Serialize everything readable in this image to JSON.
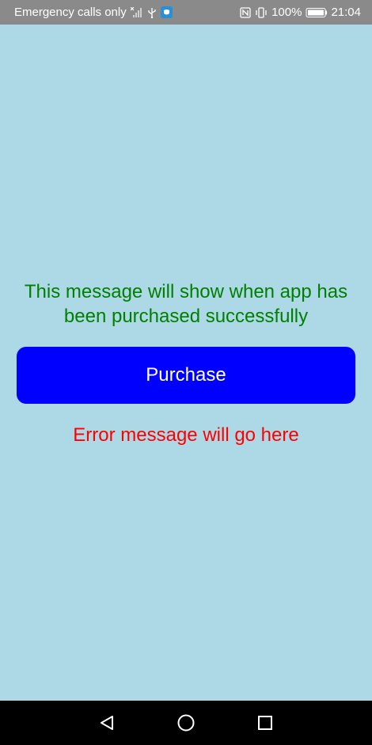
{
  "status_bar": {
    "carrier_text": "Emergency calls only",
    "battery_percent": "100%",
    "time": "21:04",
    "icons": [
      "no-signal-icon",
      "usb-icon",
      "app-notification-icon",
      "nfc-icon",
      "vibrate-icon",
      "battery-icon"
    ]
  },
  "main": {
    "success_message": "This message will show when app has been purchased successfully",
    "purchase_label": "Purchase",
    "error_message": "Error message will go here"
  },
  "nav_bar": {
    "icons": [
      "back-icon",
      "home-icon",
      "recents-icon"
    ]
  },
  "colors": {
    "background": "#ADD8E6",
    "success_text": "#008000",
    "button_bg": "#0000FF",
    "button_text": "#FFFFFF",
    "error_text": "#FF0000"
  }
}
